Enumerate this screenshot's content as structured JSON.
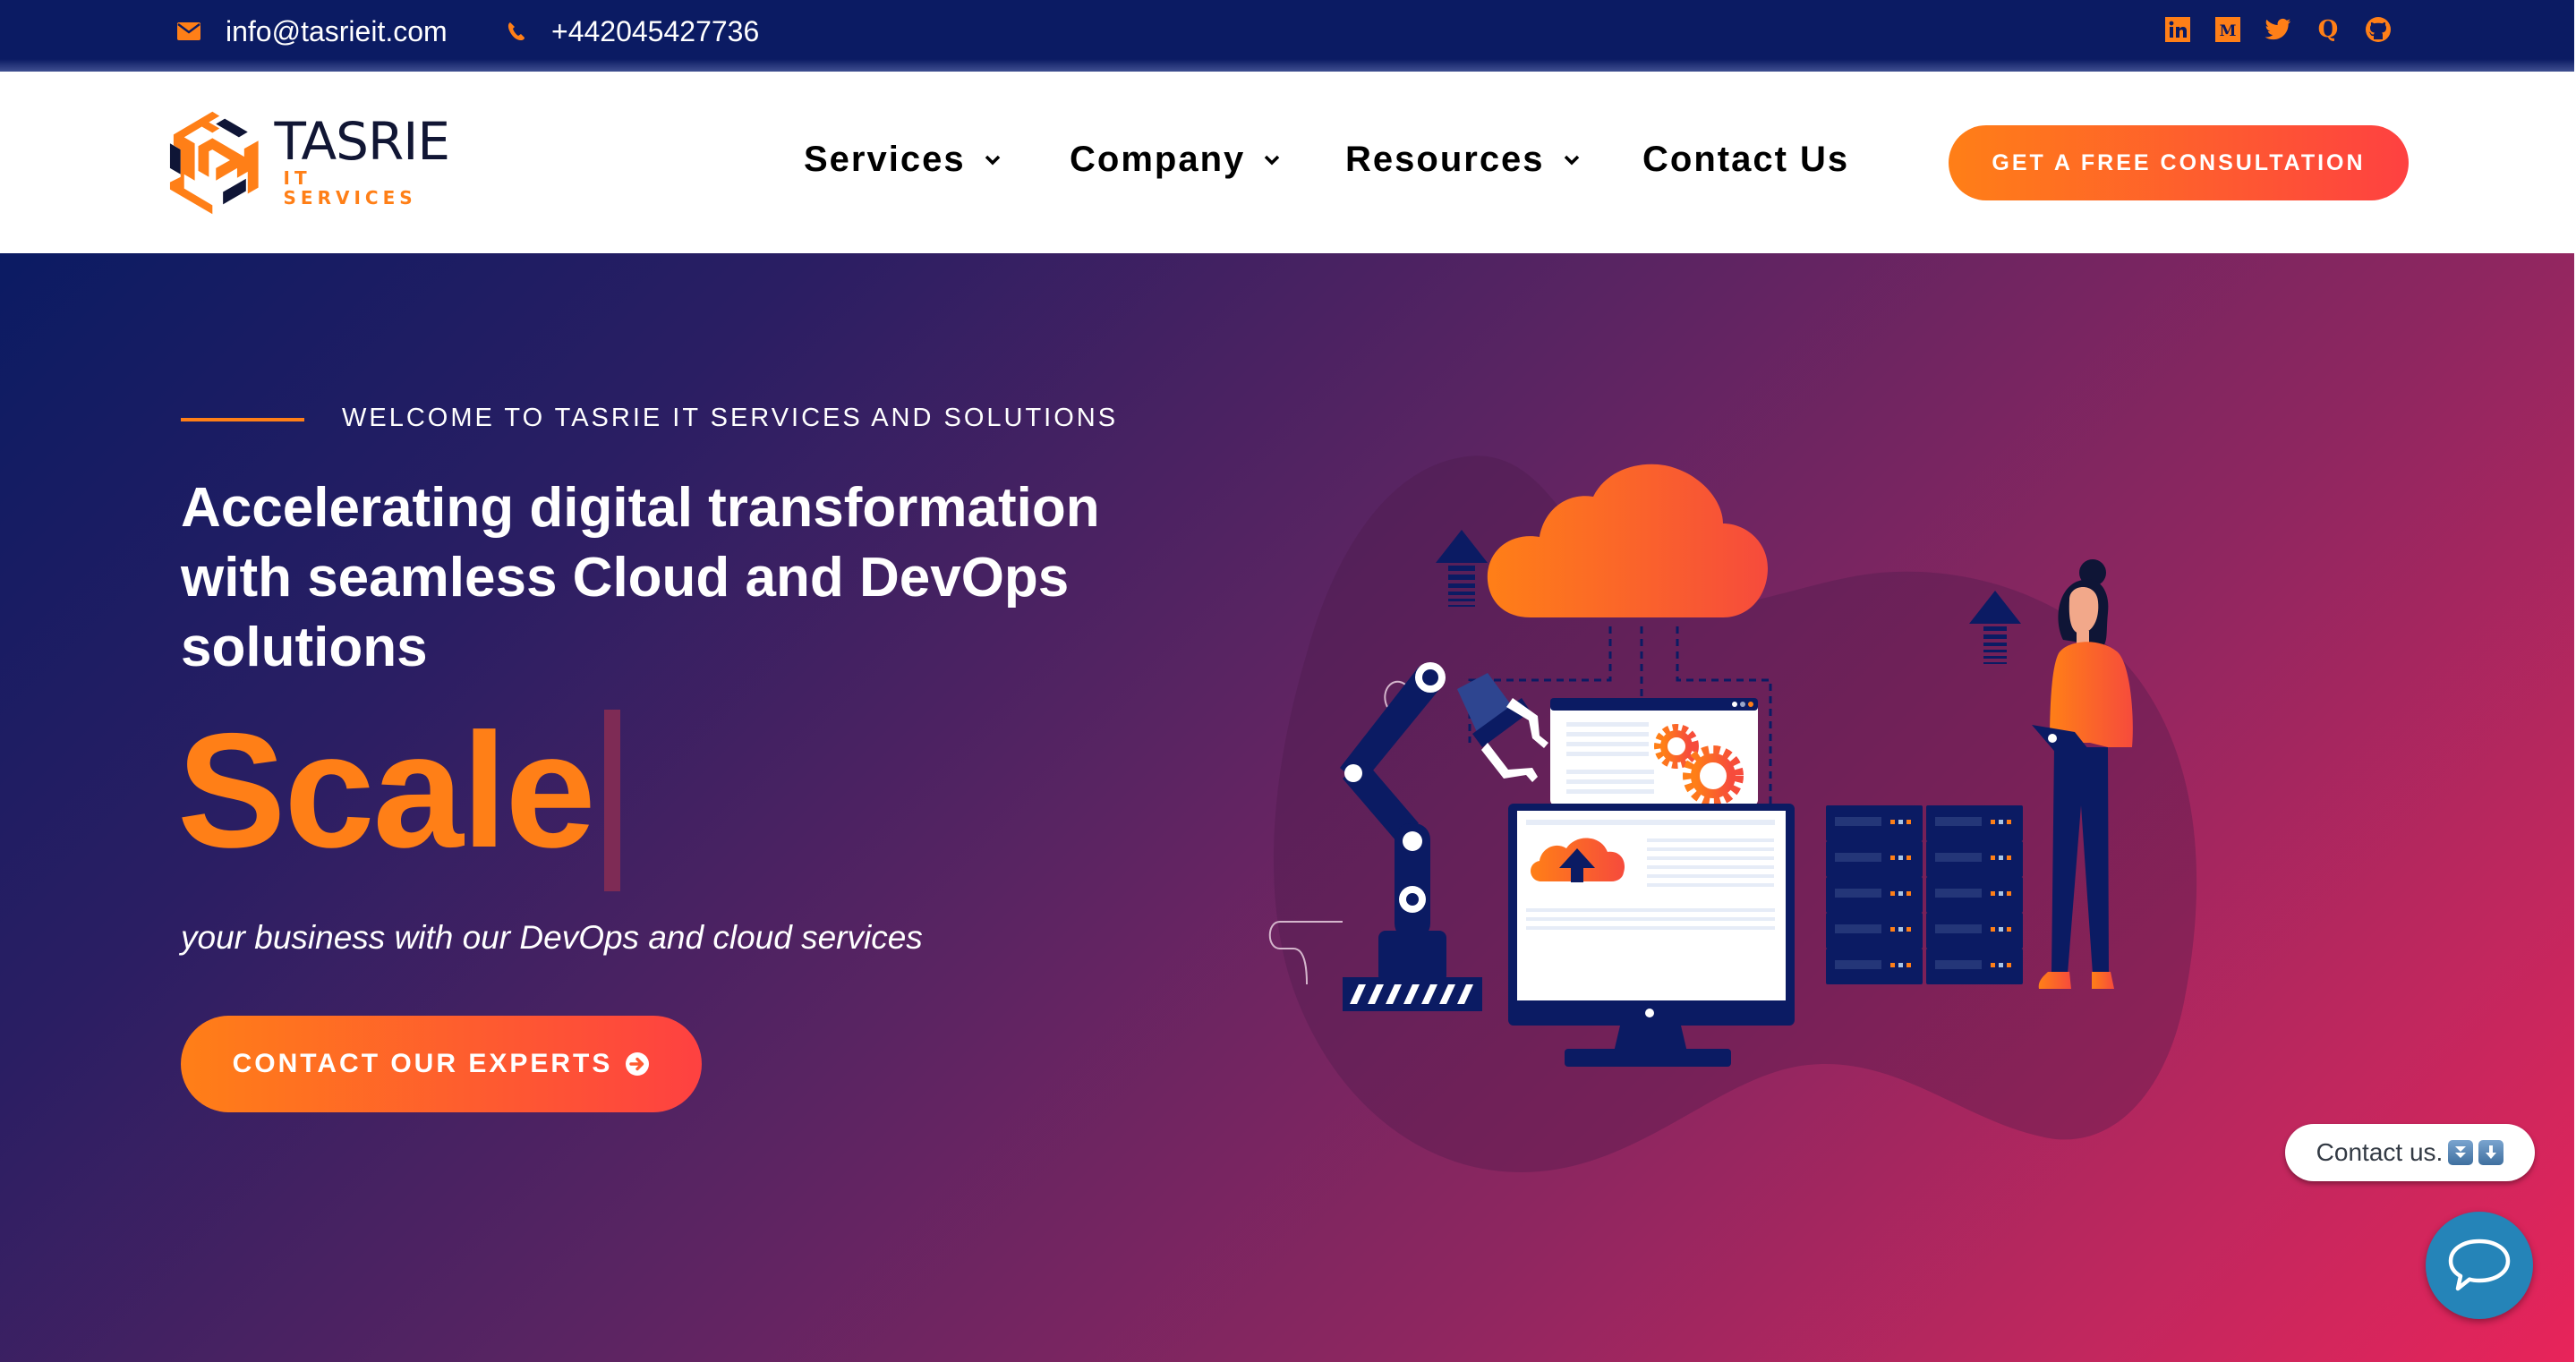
{
  "topbar": {
    "email": "info@tasrieit.com",
    "phone": "+442045427736",
    "icons": {
      "email": "envelope-icon",
      "phone": "phone-icon"
    },
    "social": [
      {
        "name": "linkedin",
        "icon": "linkedin-icon"
      },
      {
        "name": "medium",
        "icon": "medium-icon"
      },
      {
        "name": "twitter",
        "icon": "twitter-icon"
      },
      {
        "name": "quora",
        "icon": "quora-icon"
      },
      {
        "name": "github",
        "icon": "github-icon"
      }
    ]
  },
  "header": {
    "logo": {
      "title": "TASRIE",
      "subtitle": "IT SERVICES"
    },
    "nav": [
      {
        "label": "Services",
        "has_dropdown": true
      },
      {
        "label": "Company",
        "has_dropdown": true
      },
      {
        "label": "Resources",
        "has_dropdown": true
      },
      {
        "label": "Contact Us",
        "has_dropdown": false
      }
    ],
    "cta": "GET A FREE CONSULTATION"
  },
  "hero": {
    "eyebrow": "WELCOME TO TASRIE IT SERVICES AND SOLUTIONS",
    "headline_lines": [
      "Accelerating digital transformation",
      "with seamless Cloud and DevOps",
      "solutions"
    ],
    "typed_word": "Scale",
    "subtitle": "your business with our DevOps and cloud services",
    "cta": "CONTACT OUR EXPERTS",
    "illustration": "cloud-devops-illustration"
  },
  "widgets": {
    "contact_pill": "Contact us.",
    "contact_emojis": [
      "⏬",
      "⬇️"
    ],
    "chat_button": "chat-bubble-icon"
  },
  "colors": {
    "navy": "#0B1B63",
    "orange": "#FF7F17",
    "red": "#FE4141",
    "pink": "#E8245A",
    "chat_blue": "#2584B8"
  }
}
